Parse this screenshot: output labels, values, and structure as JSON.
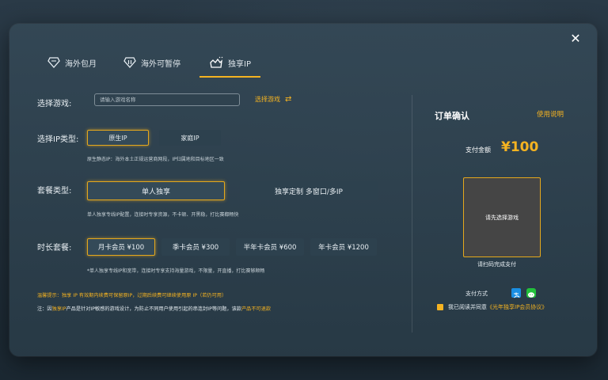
{
  "tabs": [
    {
      "label": "海外包月",
      "icon": "diamond-icon"
    },
    {
      "label": "海外可暂停",
      "icon": "pause-diamond-icon"
    },
    {
      "label": "独享IP",
      "icon": "crown-hand-icon"
    }
  ],
  "game": {
    "label": "选择游戏:",
    "placeholder": "请输入游戏名称",
    "select_link": "选择游戏",
    "switch_icon": "swap-arrows-icon"
  },
  "ip_type": {
    "label": "选择IP类型:",
    "options": [
      "原生IP",
      "家庭IP"
    ],
    "selected": 0,
    "hint": "原生静态IP：海外本土正规运营商网段，IP归属地和目标地区一致"
  },
  "package": {
    "label": "套餐类型:",
    "options": [
      "单人独享",
      "独享定制 多窗口/多IP"
    ],
    "selected": 0,
    "hint": "单人独享专线IP配置，连接时专享资源，不卡顿、开黑稳，打比赛都畅快"
  },
  "duration": {
    "label": "时长套餐:",
    "options": [
      "月卡会员 ¥100",
      "季卡会员 ¥300",
      "半年卡会员 ¥600",
      "年卡会员 ¥1200"
    ],
    "selected": 0,
    "hint": "*单人独享专线IP和宽带，连接时专享支持海量游戏，不限量，开直播，打比赛够顺畅"
  },
  "notice": {
    "warm_prefix": "温馨提示：",
    "warm_text": "独享 IP 有效期内续费可保留原IP，过期后续费可继续使用原 IP（若仍可用）",
    "note_prefix": "注：因",
    "note_highlight1": "独享IP",
    "note_middle": "产品是针对IP敏感的游戏设计，为防止不同用户使用引起的串连封IP等问题，该款",
    "note_highlight2": "产品不可退款"
  },
  "order": {
    "title": "订单确认",
    "usage_link": "使用说明",
    "amount_label": "支付金额",
    "amount_value": "¥100",
    "qr_placeholder": "请先选择游戏",
    "qr_hint": "请扫码完成支付",
    "pay_label": "支付方式",
    "pay_methods": [
      {
        "icon": "alipay-icon",
        "color": "#1a8fe3"
      },
      {
        "icon": "wechat-icon",
        "color": "#22c13b"
      }
    ],
    "agree_text": "我已阅读并同意",
    "agree_link": "《光年独享IP会员协议》"
  },
  "colors": {
    "accent": "#f5b321",
    "modal_bg": "#344856",
    "button_bg": "#2d414e"
  }
}
